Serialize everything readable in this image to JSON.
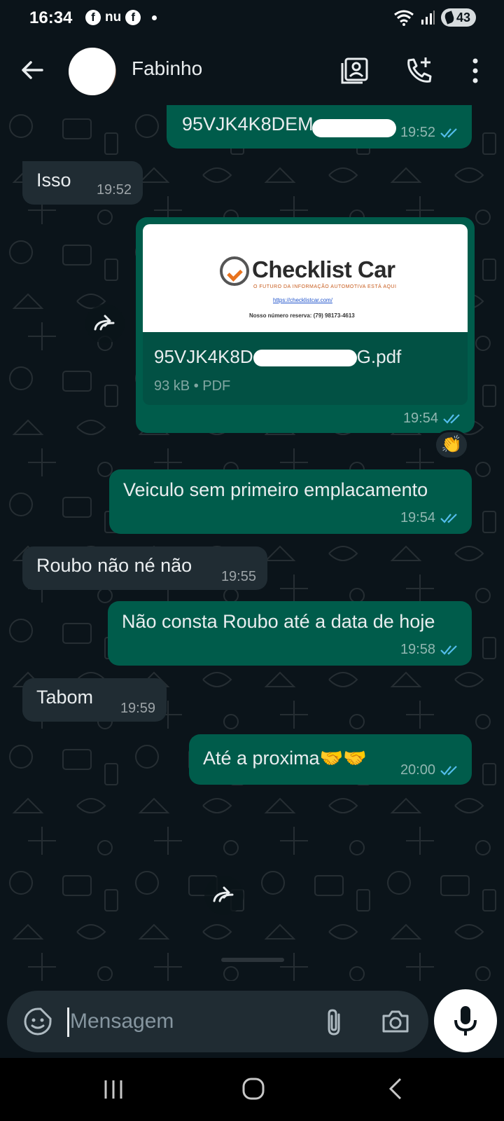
{
  "status_bar": {
    "time": "16:34",
    "app_icons": [
      "facebook-icon",
      "nubank-icon",
      "facebook-icon"
    ],
    "nu_label": "nu",
    "fb_glyph": "f",
    "battery": "43"
  },
  "header": {
    "contact_name": "Fabinho",
    "icons": [
      "back-arrow-icon",
      "contact-card-icon",
      "add-call-icon",
      "more-vertical-icon"
    ]
  },
  "messages": [
    {
      "side": "out",
      "text": "95VJK4K8DEM",
      "time": "19:52",
      "status": "read"
    },
    {
      "side": "in",
      "text": "Isso",
      "time": "19:52"
    },
    {
      "side": "out",
      "type": "document",
      "file_name_prefix": "95VJK4K8D",
      "file_name_suffix": "G.pdf",
      "file_meta": "93 kB • PDF",
      "time": "19:54",
      "status": "read",
      "preview": {
        "brand": "Checklist Car",
        "tagline": "O FUTURO DA INFORMAÇÃO AUTOMOTIVA ESTÁ AQUI",
        "url": "https://checklistcar.com/",
        "phone": "Nosso número reserva: (79) 98173-4613"
      },
      "reaction": "👏"
    },
    {
      "side": "out",
      "text": "Veiculo sem primeiro emplacamento",
      "time": "19:54",
      "status": "read"
    },
    {
      "side": "in",
      "text": "Roubo não né não",
      "time": "19:55"
    },
    {
      "side": "out",
      "text": "Não consta Roubo até a data de hoje",
      "time": "19:58",
      "status": "read"
    },
    {
      "side": "in",
      "text": "Tabom",
      "time": "19:59"
    },
    {
      "side": "out",
      "text": "Até a proxima🤝🤝",
      "time": "20:00",
      "status": "read"
    }
  ],
  "input": {
    "placeholder": "Mensagem"
  },
  "colors": {
    "background": "#0b141a",
    "outgoing_bubble": "#005c4b",
    "incoming_bubble": "#202c33",
    "read_ticks": "#53bdeb"
  }
}
